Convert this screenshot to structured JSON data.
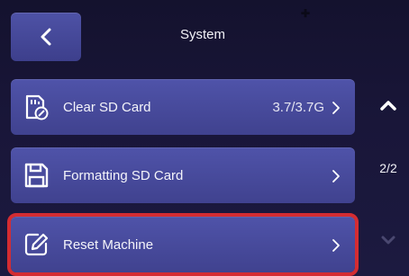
{
  "header": {
    "title": "System",
    "back_icon": "chevron-left-icon"
  },
  "items": [
    {
      "label": "Clear SD Card",
      "value": "3.7/3.7G",
      "icon": "sd-card-clear-icon"
    },
    {
      "label": "Formatting SD Card",
      "value": "",
      "icon": "save-disk-icon"
    },
    {
      "label": "Reset Machine",
      "value": "",
      "icon": "edit-icon",
      "selected": true
    }
  ],
  "pager": {
    "text": "2/2",
    "up_icon": "chevron-up-icon",
    "down_icon": "chevron-down-icon"
  },
  "colors": {
    "background": "#191639",
    "card": "#474a9c",
    "selection": "#d42c32"
  }
}
